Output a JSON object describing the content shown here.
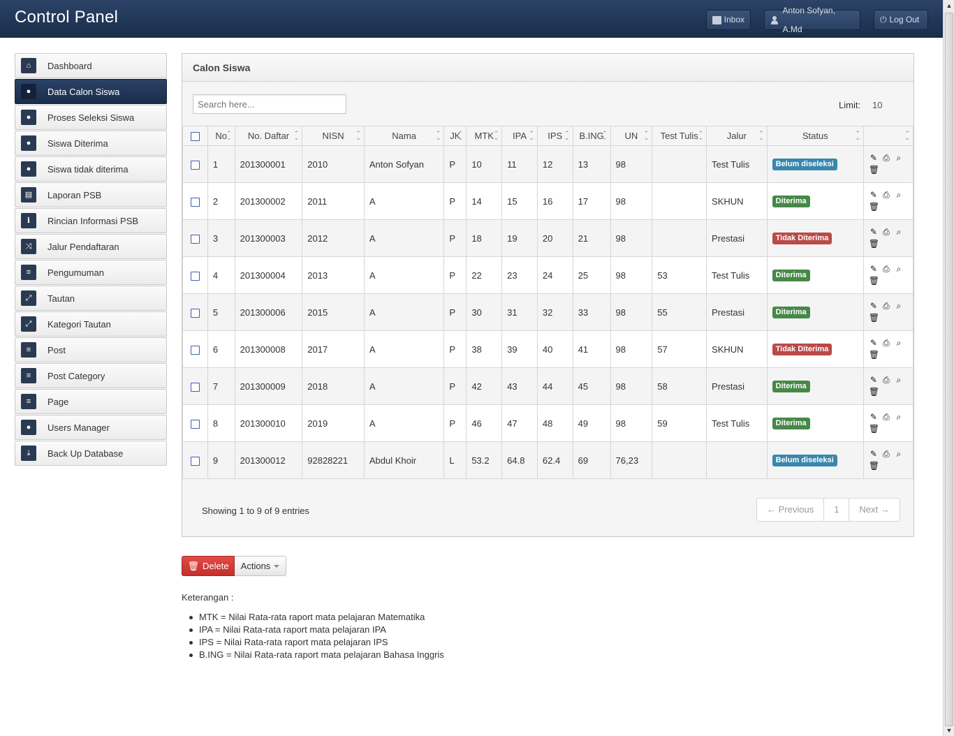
{
  "header": {
    "brand": "Control Panel",
    "inbox_label": "Inbox",
    "user_label": "Anton Sofyan, A.Md",
    "logout_label": "Log Out"
  },
  "sidebar": {
    "items": [
      {
        "label": "Dashboard",
        "icon": "home-icon",
        "glyph": "⌂",
        "active": false
      },
      {
        "label": "Data Calon Siswa",
        "icon": "user-icon",
        "glyph": "●",
        "active": true
      },
      {
        "label": "Proses Seleksi Siswa",
        "icon": "user-icon",
        "glyph": "●",
        "active": false
      },
      {
        "label": "Siswa Diterima",
        "icon": "user-icon",
        "glyph": "●",
        "active": false
      },
      {
        "label": "Siswa tidak diterima",
        "icon": "user-icon",
        "glyph": "●",
        "active": false
      },
      {
        "label": "Laporan PSB",
        "icon": "print-icon",
        "glyph": "▤",
        "active": false
      },
      {
        "label": "Rincian Informasi PSB",
        "icon": "info-icon",
        "glyph": "ℹ",
        "active": false
      },
      {
        "label": "Jalur Pendaftaran",
        "icon": "shuffle-icon",
        "glyph": "⤨",
        "active": false
      },
      {
        "label": "Pengumuman",
        "icon": "align-left-icon",
        "glyph": "≡",
        "active": false
      },
      {
        "label": "Tautan",
        "icon": "resize-icon",
        "glyph": "⤢",
        "active": false
      },
      {
        "label": "Kategori Tautan",
        "icon": "resize-icon",
        "glyph": "⤢",
        "active": false
      },
      {
        "label": "Post",
        "icon": "align-left-icon",
        "glyph": "≡",
        "active": false
      },
      {
        "label": "Post Category",
        "icon": "align-left-icon",
        "glyph": "≡",
        "active": false
      },
      {
        "label": "Page",
        "icon": "align-left-icon",
        "glyph": "≡",
        "active": false
      },
      {
        "label": "Users Manager",
        "icon": "user-icon",
        "glyph": "●",
        "active": false
      },
      {
        "label": "Back Up Database",
        "icon": "download-icon",
        "glyph": "⤓",
        "active": false
      }
    ]
  },
  "panel": {
    "title": "Calon Siswa",
    "search_placeholder": "Search here...",
    "limit_label": "Limit:",
    "limit_value": "10"
  },
  "table": {
    "columns": [
      "No",
      "No. Daftar",
      "NISN",
      "Nama",
      "JK",
      "MTK",
      "IPA",
      "IPS",
      "B.ING",
      "UN",
      "Test Tulis",
      "Jalur",
      "Status",
      ""
    ],
    "rows": [
      {
        "no": "1",
        "daftar": "201300001",
        "nisn": "2010",
        "nama": "Anton Sofyan",
        "jk": "P",
        "mtk": "10",
        "ipa": "11",
        "ips": "12",
        "bing": "13",
        "un": "98",
        "test": "",
        "jalur": "Test Tulis",
        "status": "Belum diseleksi",
        "status_color": "blue"
      },
      {
        "no": "2",
        "daftar": "201300002",
        "nisn": "2011",
        "nama": "A",
        "jk": "P",
        "mtk": "14",
        "ipa": "15",
        "ips": "16",
        "bing": "17",
        "un": "98",
        "test": "",
        "jalur": "SKHUN",
        "status": "Diterima",
        "status_color": "green"
      },
      {
        "no": "3",
        "daftar": "201300003",
        "nisn": "2012",
        "nama": "A",
        "jk": "P",
        "mtk": "18",
        "ipa": "19",
        "ips": "20",
        "bing": "21",
        "un": "98",
        "test": "",
        "jalur": "Prestasi",
        "status": "Tidak Diterima",
        "status_color": "red"
      },
      {
        "no": "4",
        "daftar": "201300004",
        "nisn": "2013",
        "nama": "A",
        "jk": "P",
        "mtk": "22",
        "ipa": "23",
        "ips": "24",
        "bing": "25",
        "un": "98",
        "test": "53",
        "jalur": "Test Tulis",
        "status": "Diterima",
        "status_color": "green"
      },
      {
        "no": "5",
        "daftar": "201300006",
        "nisn": "2015",
        "nama": "A",
        "jk": "P",
        "mtk": "30",
        "ipa": "31",
        "ips": "32",
        "bing": "33",
        "un": "98",
        "test": "55",
        "jalur": "Prestasi",
        "status": "Diterima",
        "status_color": "green"
      },
      {
        "no": "6",
        "daftar": "201300008",
        "nisn": "2017",
        "nama": "A",
        "jk": "P",
        "mtk": "38",
        "ipa": "39",
        "ips": "40",
        "bing": "41",
        "un": "98",
        "test": "57",
        "jalur": "SKHUN",
        "status": "Tidak Diterima",
        "status_color": "red"
      },
      {
        "no": "7",
        "daftar": "201300009",
        "nisn": "2018",
        "nama": "A",
        "jk": "P",
        "mtk": "42",
        "ipa": "43",
        "ips": "44",
        "bing": "45",
        "un": "98",
        "test": "58",
        "jalur": "Prestasi",
        "status": "Diterima",
        "status_color": "green"
      },
      {
        "no": "8",
        "daftar": "201300010",
        "nisn": "2019",
        "nama": "A",
        "jk": "P",
        "mtk": "46",
        "ipa": "47",
        "ips": "48",
        "bing": "49",
        "un": "98",
        "test": "59",
        "jalur": "Test Tulis",
        "status": "Diterima",
        "status_color": "green"
      },
      {
        "no": "9",
        "daftar": "201300012",
        "nisn": "92828221",
        "nama": "Abdul Khoir",
        "jk": "L",
        "mtk": "53.2",
        "ipa": "64.8",
        "ips": "62.4",
        "bing": "69",
        "un": "76,23",
        "test": "",
        "jalur": "",
        "status": "Belum diseleksi",
        "status_color": "blue"
      }
    ]
  },
  "footer": {
    "showing": "Showing 1 to 9 of 9 entries",
    "prev": "← Previous",
    "page": "1",
    "next": "Next →"
  },
  "bulk": {
    "delete_label": "Delete",
    "actions_label": "Actions"
  },
  "keterangan": {
    "title": "Keterangan :",
    "items": [
      "MTK = Nilai Rata-rata raport mata pelajaran Matematika",
      "IPA = Nilai Rata-rata raport mata pelajaran IPA",
      "IPS = Nilai Rata-rata raport mata pelajaran IPS",
      "B.ING = Nilai Rata-rata raport mata pelajaran Bahasa Inggris"
    ]
  },
  "colors": {
    "header": "#1f3353",
    "badge_blue": "#3a87ad",
    "badge_green": "#468847",
    "badge_red": "#b94a48",
    "delete": "#d9403c"
  }
}
